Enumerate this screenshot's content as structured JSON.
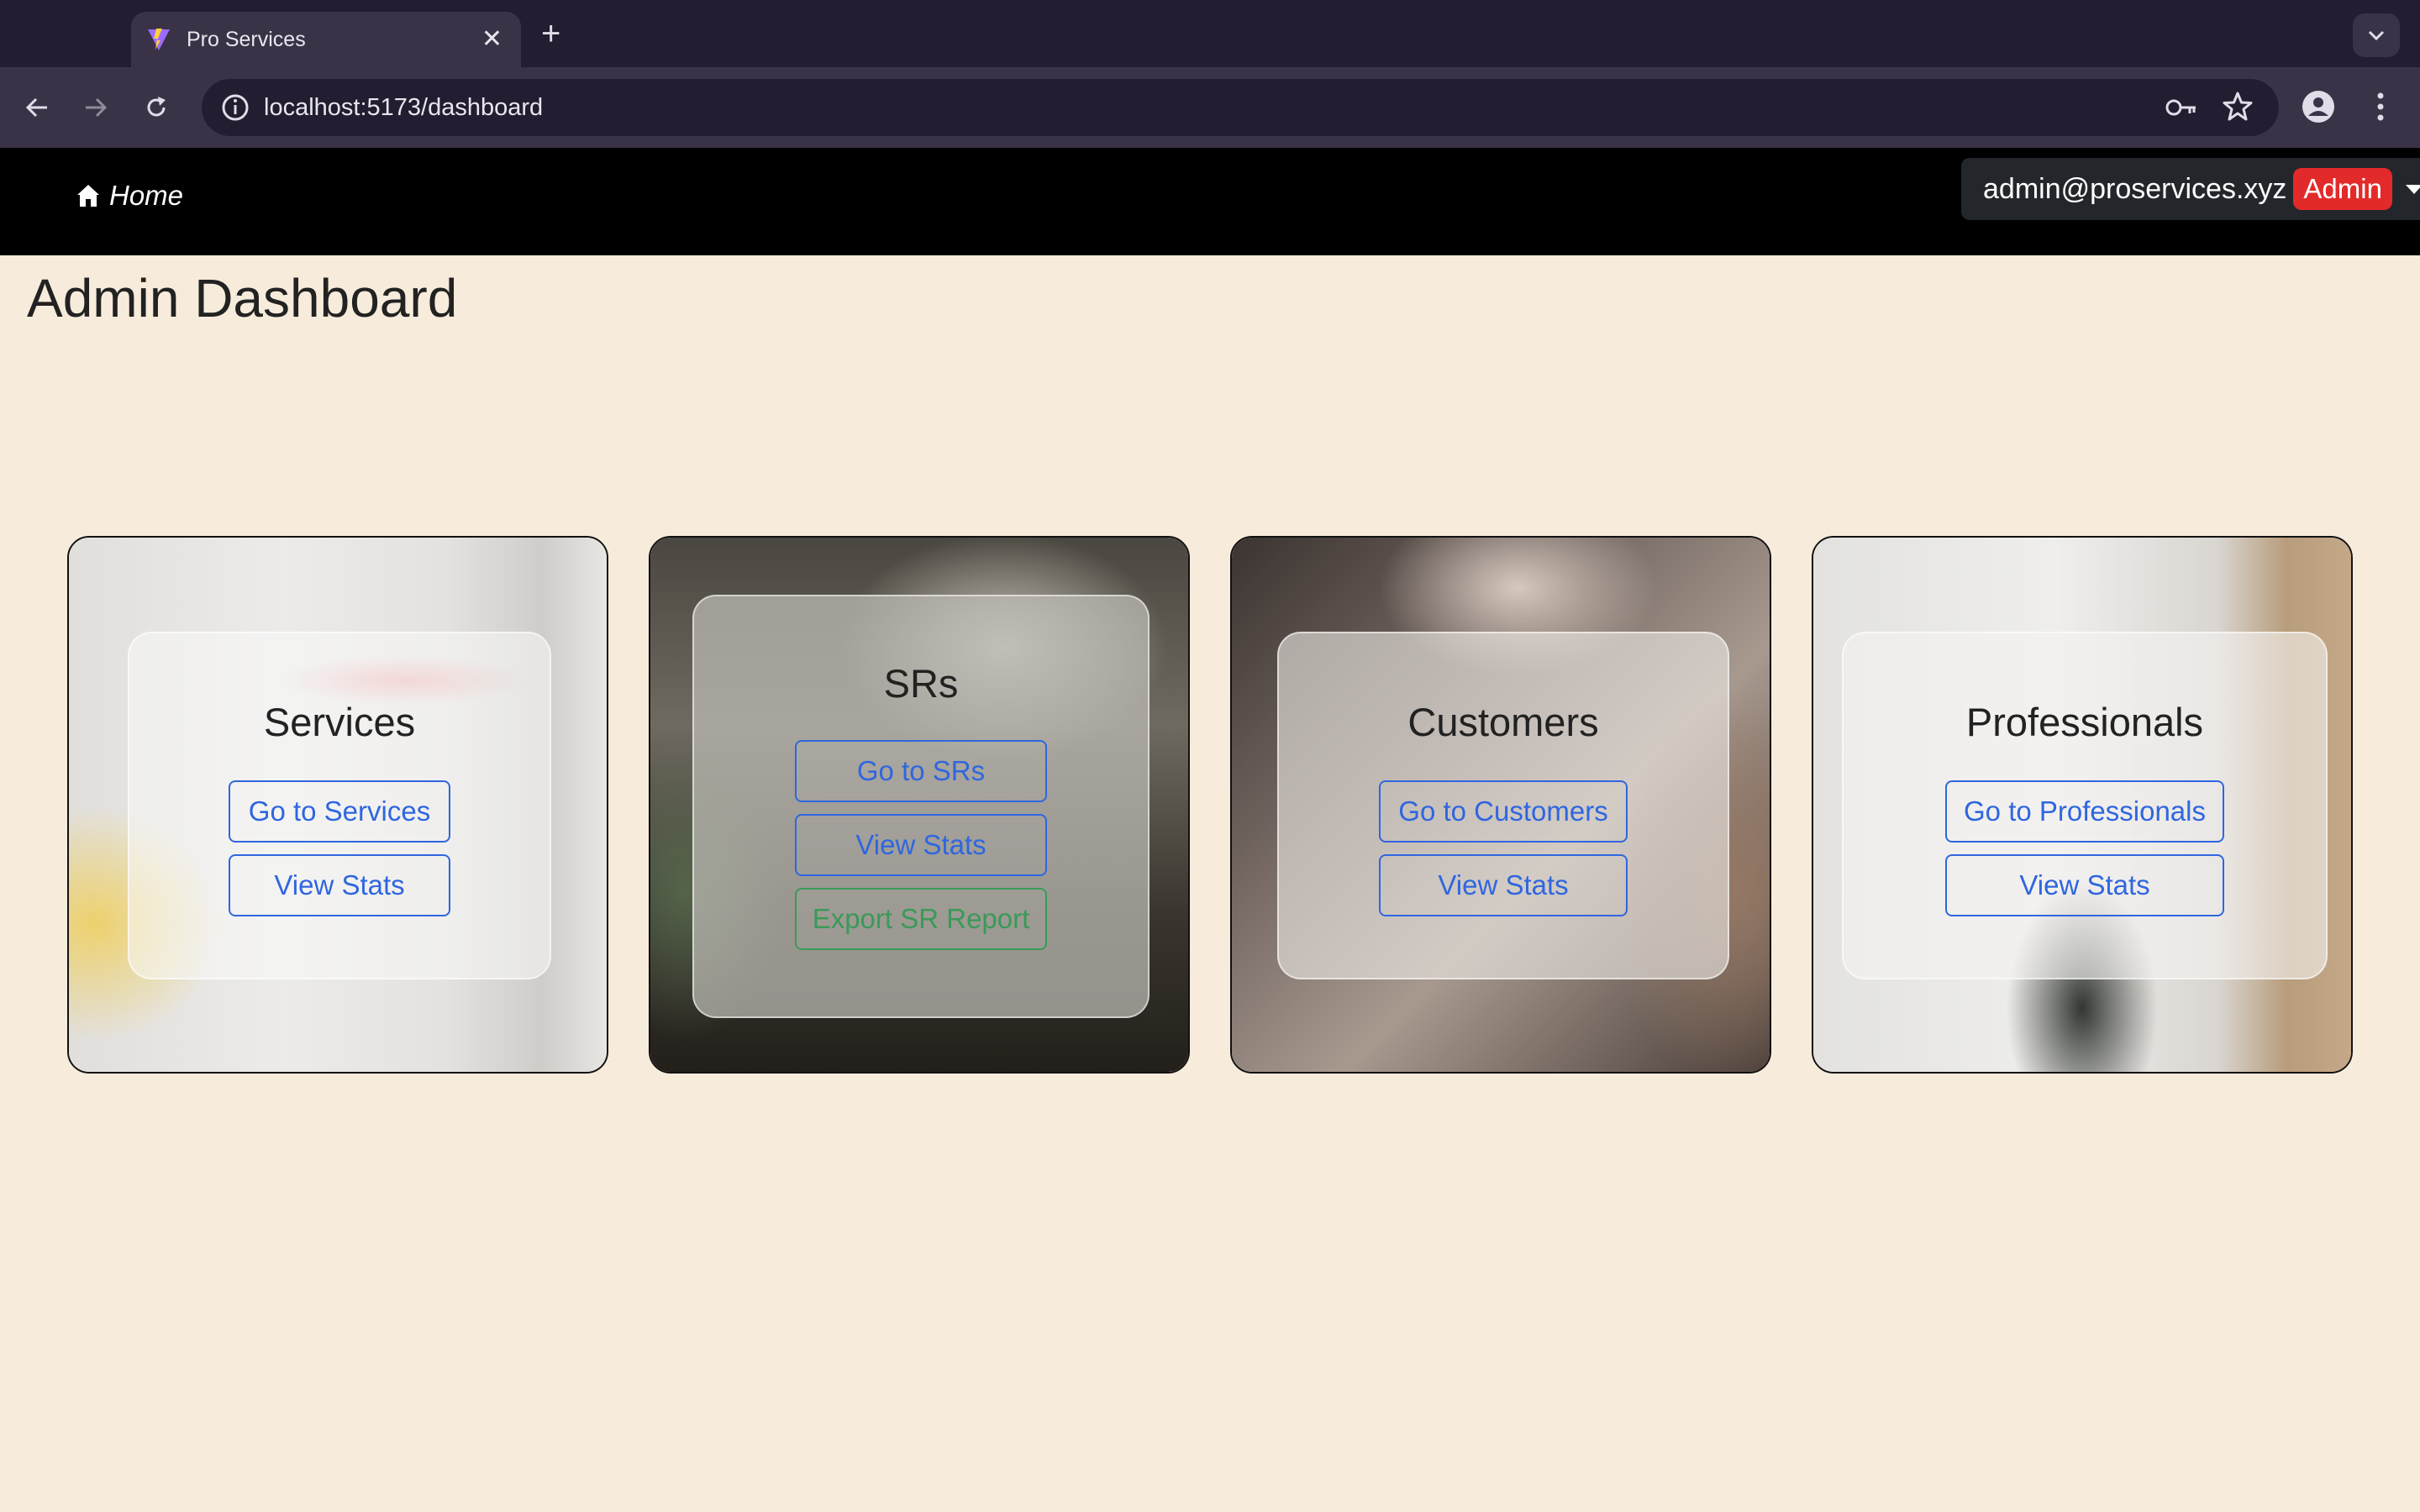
{
  "browser": {
    "tab_title": "Pro Services",
    "url": "localhost:5173/dashboard"
  },
  "navbar": {
    "home_label": "Home",
    "user_email": "admin@proservices.xyz",
    "role_badge": "Admin"
  },
  "page": {
    "title": "Admin Dashboard"
  },
  "cards": [
    {
      "title": "Services",
      "buttons": [
        "Go to Services",
        "View Stats"
      ]
    },
    {
      "title": "SRs",
      "buttons": [
        "Go to SRs",
        "View Stats",
        "Export SR Report"
      ]
    },
    {
      "title": "Customers",
      "buttons": [
        "Go to Customers",
        "View Stats"
      ]
    },
    {
      "title": "Professionals",
      "buttons": [
        "Go to Professionals",
        "View Stats"
      ]
    }
  ],
  "colors": {
    "page_background": "#f7ecdb",
    "navbar": "#000000",
    "badge_red": "#e32a2a",
    "primary_button": "#2f66e0",
    "success_button": "#3a9a58"
  }
}
